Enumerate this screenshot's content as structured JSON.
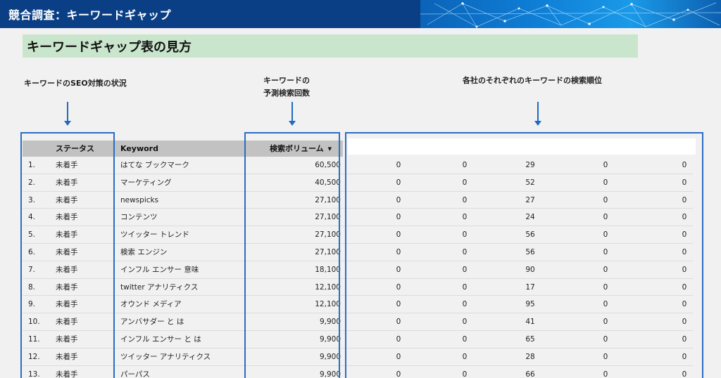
{
  "header": {
    "title": "競合調査：キーワードギャップ"
  },
  "section": {
    "heading": "キーワードギャップ表の見方"
  },
  "annotations": {
    "status": "キーワードのSEO対策の状況",
    "volume_line1": "キーワードの",
    "volume_line2": "予測検索回数",
    "rank": "各社のそれぞれのキーワードの検索順位"
  },
  "table": {
    "columns": {
      "status": "ステータス",
      "keyword": "Keyword",
      "volume": "検索ボリューム"
    },
    "rows": [
      {
        "idx": "1.",
        "status": "未着手",
        "keyword": "はてな ブックマーク",
        "volume": "60,500",
        "ranks": [
          "0",
          "0",
          "29",
          "0",
          "0"
        ]
      },
      {
        "idx": "2.",
        "status": "未着手",
        "keyword": "マーケティング",
        "volume": "40,500",
        "ranks": [
          "0",
          "0",
          "52",
          "0",
          "0"
        ]
      },
      {
        "idx": "3.",
        "status": "未着手",
        "keyword": "newspicks",
        "volume": "27,100",
        "ranks": [
          "0",
          "0",
          "27",
          "0",
          "0"
        ]
      },
      {
        "idx": "4.",
        "status": "未着手",
        "keyword": "コンテンツ",
        "volume": "27,100",
        "ranks": [
          "0",
          "0",
          "24",
          "0",
          "0"
        ]
      },
      {
        "idx": "5.",
        "status": "未着手",
        "keyword": "ツイッター トレンド",
        "volume": "27,100",
        "ranks": [
          "0",
          "0",
          "56",
          "0",
          "0"
        ]
      },
      {
        "idx": "6.",
        "status": "未着手",
        "keyword": "検索 エンジン",
        "volume": "27,100",
        "ranks": [
          "0",
          "0",
          "56",
          "0",
          "0"
        ]
      },
      {
        "idx": "7.",
        "status": "未着手",
        "keyword": "インフル エンサー 意味",
        "volume": "18,100",
        "ranks": [
          "0",
          "0",
          "90",
          "0",
          "0"
        ]
      },
      {
        "idx": "8.",
        "status": "未着手",
        "keyword": "twitter アナリティクス",
        "volume": "12,100",
        "ranks": [
          "0",
          "0",
          "17",
          "0",
          "0"
        ]
      },
      {
        "idx": "9.",
        "status": "未着手",
        "keyword": "オウンド メディア",
        "volume": "12,100",
        "ranks": [
          "0",
          "0",
          "95",
          "0",
          "0"
        ]
      },
      {
        "idx": "10.",
        "status": "未着手",
        "keyword": "アンバサダー と は",
        "volume": "9,900",
        "ranks": [
          "0",
          "0",
          "41",
          "0",
          "0"
        ]
      },
      {
        "idx": "11.",
        "status": "未着手",
        "keyword": "インフル エンサー と は",
        "volume": "9,900",
        "ranks": [
          "0",
          "0",
          "65",
          "0",
          "0"
        ]
      },
      {
        "idx": "12.",
        "status": "未着手",
        "keyword": "ツイッター アナリティクス",
        "volume": "9,900",
        "ranks": [
          "0",
          "0",
          "28",
          "0",
          "0"
        ]
      },
      {
        "idx": "13.",
        "status": "未着手",
        "keyword": "パーパス",
        "volume": "9,900",
        "ranks": [
          "0",
          "0",
          "66",
          "0",
          "0"
        ]
      }
    ]
  },
  "colors": {
    "header_bg": "#0a3f86",
    "heading_bg": "#c9e5cc",
    "highlight": "#2b6cc4",
    "table_header_bg": "#c2c2c2"
  },
  "icons": {
    "sort": "sort-down-icon",
    "arrow": "arrow-down-icon"
  }
}
